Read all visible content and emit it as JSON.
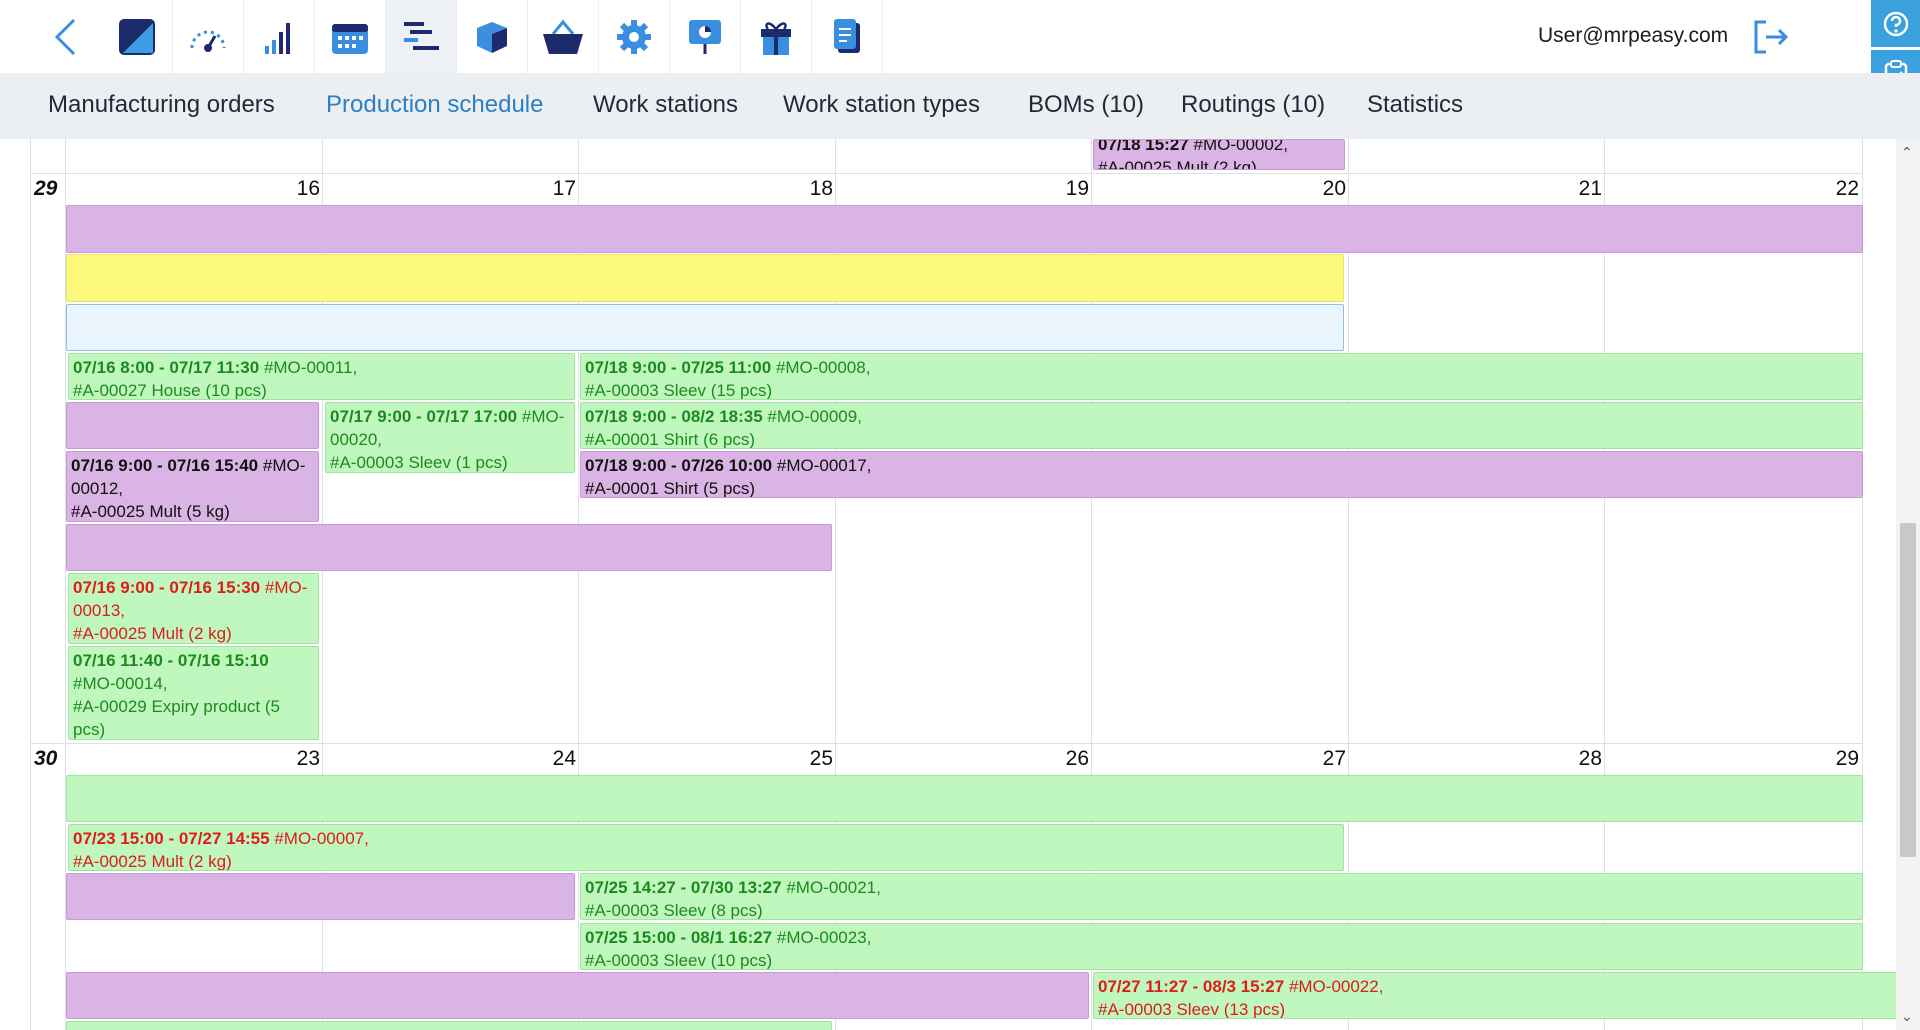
{
  "toolbar": {
    "icons": [
      "back-icon",
      "logo-icon",
      "dashboard-icon",
      "stats-icon",
      "calendar-icon",
      "schedule-icon",
      "cube-icon",
      "basket-icon",
      "gear-icon",
      "presentation-icon",
      "gift-icon",
      "document-icon"
    ],
    "user_email": "User@mrpeasy.com"
  },
  "tabs": [
    {
      "label": "Manufacturing orders",
      "active": false
    },
    {
      "label": "Production schedule",
      "active": true
    },
    {
      "label": "Work stations",
      "active": false
    },
    {
      "label": "Work station types",
      "active": false
    },
    {
      "label": "BOMs (10)",
      "active": false
    },
    {
      "label": "Routings (10)",
      "active": false
    },
    {
      "label": "Statistics",
      "active": false
    }
  ],
  "colors": {
    "accent": "#2b7fc4",
    "purple": "#dab4e4",
    "green": "#bff7bf",
    "yellow": "#fbfa7e",
    "red": "#e01b1b",
    "dark_green": "#1d8a1d"
  },
  "prev_week": {
    "event_top": {
      "time": "07/18 15:27",
      "mo": "#MO-00002,",
      "article": "#A-00025 Mult (2 kg)"
    }
  },
  "week29": {
    "week": "29",
    "days": [
      "16",
      "17",
      "18",
      "19",
      "20",
      "21",
      "22"
    ],
    "events": [
      {
        "time": "07/16 8:00 - 07/17 11:30",
        "mo": "#MO-00011,",
        "article": "#A-00027 House (10 pcs)"
      },
      {
        "time": "07/18 9:00 - 07/25 11:00",
        "mo": "#MO-00008,",
        "article": "#A-00003 Sleev (15 pcs)"
      },
      {
        "time": "07/17 9:00 - 07/17 17:00",
        "mo": "#MO-00020,",
        "article": "#A-00003 Sleev (1 pcs)"
      },
      {
        "time": "07/18 9:00 - 08/2 18:35",
        "mo": "#MO-00009,",
        "article": "#A-00001 Shirt (6 pcs)"
      },
      {
        "time": "07/16 9:00 - 07/16 15:40",
        "mo": "#MO-00012,",
        "article": "#A-00025 Mult (5 kg)"
      },
      {
        "time": "07/18 9:00 - 07/26 10:00",
        "mo": "#MO-00017,",
        "article": "#A-00001 Shirt (5 pcs)"
      },
      {
        "time": "07/16 9:00 - 07/16 15:30",
        "mo": "#MO-00013,",
        "article": "#A-00025 Mult (2 kg)"
      },
      {
        "time": "07/16 11:40 - 07/16 15:10",
        "mo": "#MO-00014,",
        "article": "#A-00029 Expiry product (5 pcs)"
      }
    ]
  },
  "week30": {
    "week": "30",
    "days": [
      "23",
      "24",
      "25",
      "26",
      "27",
      "28",
      "29"
    ],
    "events": [
      {
        "time": "07/23 15:00 - 07/27 14:55",
        "mo": "#MO-00007,",
        "article": "#A-00025 Mult (2 kg)"
      },
      {
        "time": "07/25 14:27 - 07/30 13:27",
        "mo": "#MO-00021,",
        "article": "#A-00003 Sleev (8 pcs)"
      },
      {
        "time": "07/25 15:00 - 08/1 16:27",
        "mo": "#MO-00023,",
        "article": "#A-00003 Sleev (10 pcs)"
      },
      {
        "time": "07/27 11:27 - 08/3 15:27",
        "mo": "#MO-00022,",
        "article": "#A-00003 Sleev (13 pcs)"
      }
    ]
  }
}
